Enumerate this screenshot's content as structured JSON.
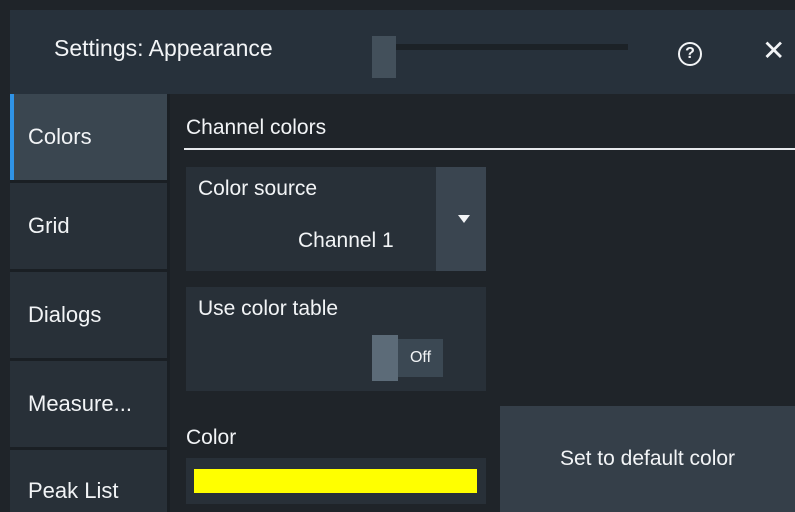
{
  "dialog": {
    "title": "Settings: Appearance",
    "help_icon_glyph": "?",
    "close_icon_glyph": "✕"
  },
  "sidebar": {
    "items": [
      {
        "label": "Colors",
        "active": true
      },
      {
        "label": "Grid",
        "active": false
      },
      {
        "label": "Dialogs",
        "active": false
      },
      {
        "label": "Measure...",
        "active": false
      },
      {
        "label": "Peak List",
        "active": false
      }
    ]
  },
  "content": {
    "section_title": "Channel colors",
    "color_source": {
      "label": "Color source",
      "value": "Channel 1"
    },
    "use_color_table": {
      "label": "Use color table",
      "state": "Off"
    },
    "color": {
      "label": "Color",
      "swatch": "#ffff00"
    },
    "default_button": "Set to default color"
  },
  "colors": {
    "accent": "#2f93e6",
    "background": "#1f2429",
    "panel": "#283038"
  }
}
